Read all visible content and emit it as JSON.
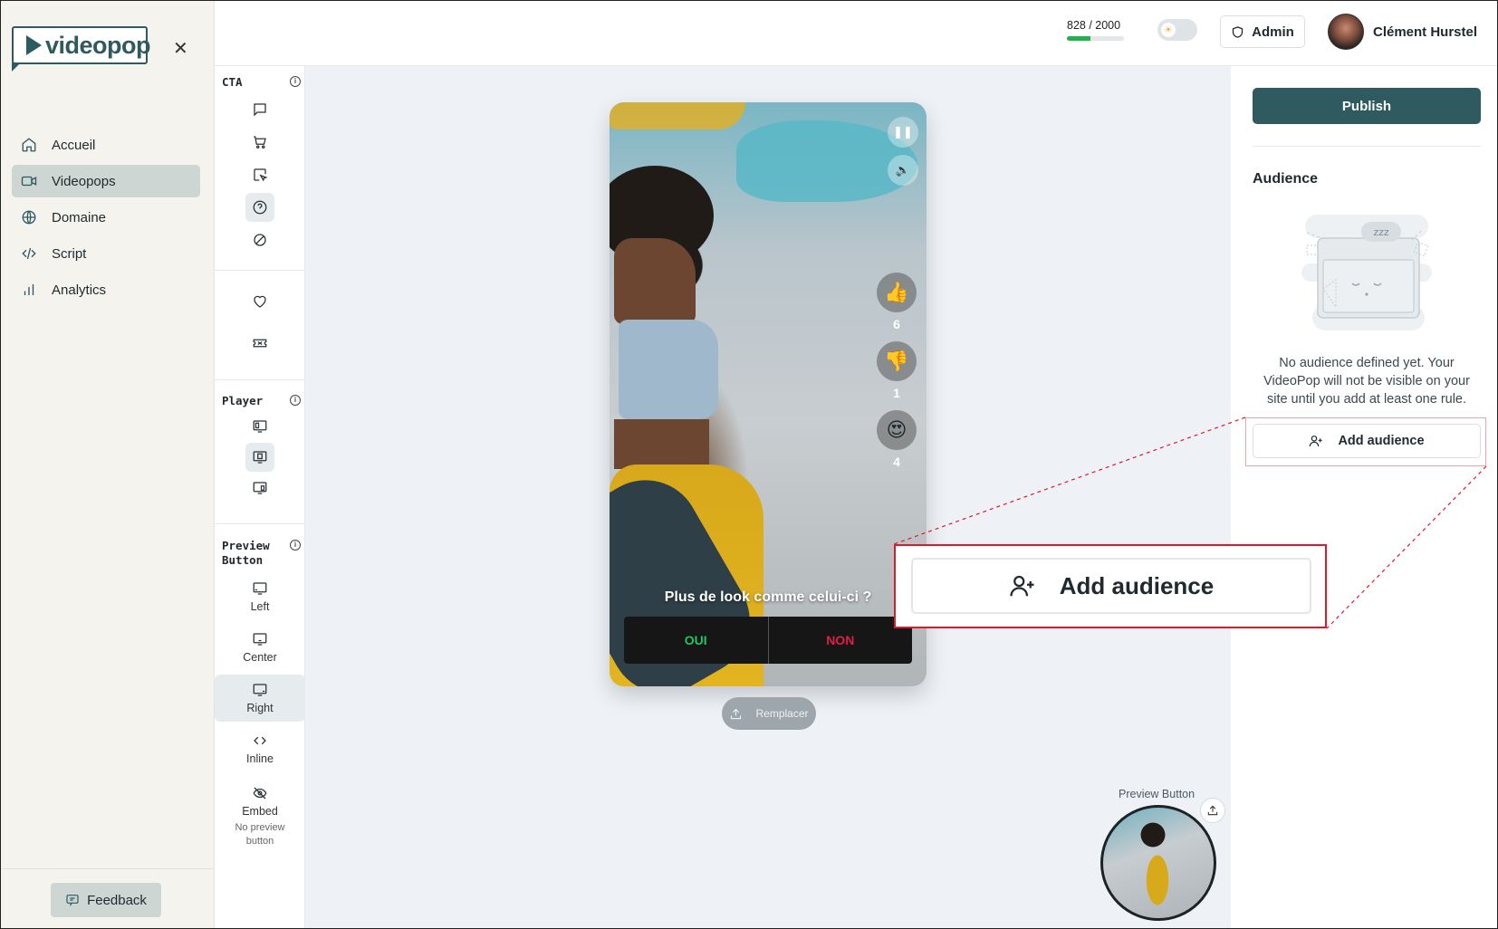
{
  "brand": {
    "name": "videopop",
    "color": "#2f5a60"
  },
  "sidebar": {
    "close_icon": "close-icon",
    "items": [
      {
        "label": "Accueil",
        "icon": "home-icon",
        "active": false
      },
      {
        "label": "Videopops",
        "icon": "video-icon",
        "active": true
      },
      {
        "label": "Domaine",
        "icon": "globe-icon",
        "active": false
      },
      {
        "label": "Script",
        "icon": "code-icon",
        "active": false
      },
      {
        "label": "Analytics",
        "icon": "bar-chart-icon",
        "active": false
      }
    ],
    "feedback_label": "Feedback"
  },
  "header": {
    "quota_text": "828 / 2000",
    "quota_used": 828,
    "quota_total": 2000,
    "quota_color": "#1fb24d",
    "admin_label": "Admin",
    "user_name": "Clément Hurstel"
  },
  "tools": {
    "cta_title": "CTA",
    "player_title": "Player",
    "preview_title_line1": "Preview",
    "preview_title_line2": "Button",
    "preview_options": [
      {
        "label": "Left",
        "icon": "monitor-left-icon",
        "active": false
      },
      {
        "label": "Center",
        "icon": "monitor-center-icon",
        "active": false
      },
      {
        "label": "Right",
        "icon": "monitor-right-icon",
        "active": true
      },
      {
        "label": "Inline",
        "icon": "code-brackets-icon",
        "active": false
      },
      {
        "label": "Embed",
        "icon": "eye-off-icon",
        "active": false
      }
    ],
    "embed_sub": "No preview button"
  },
  "player": {
    "reactions": [
      {
        "emoji": "👍",
        "count": "6"
      },
      {
        "emoji": "👎",
        "count": "1"
      },
      {
        "emoji": "😍",
        "count": "4"
      }
    ],
    "question": "Plus de look comme celui-ci ?",
    "answer_yes": "OUI",
    "answer_no": "NON",
    "replace_label": "Remplacer"
  },
  "preview_button": {
    "label": "Preview Button"
  },
  "right_panel": {
    "publish_label": "Publish",
    "audience_title": "Audience",
    "illustration_text": "zzz",
    "empty_text": "No audience defined yet. Your VideoPop will not be visible on your site until you add at least one rule.",
    "add_audience_label": "Add audience"
  },
  "zoom_callout": {
    "label": "Add audience",
    "border_color": "#e0182a"
  }
}
